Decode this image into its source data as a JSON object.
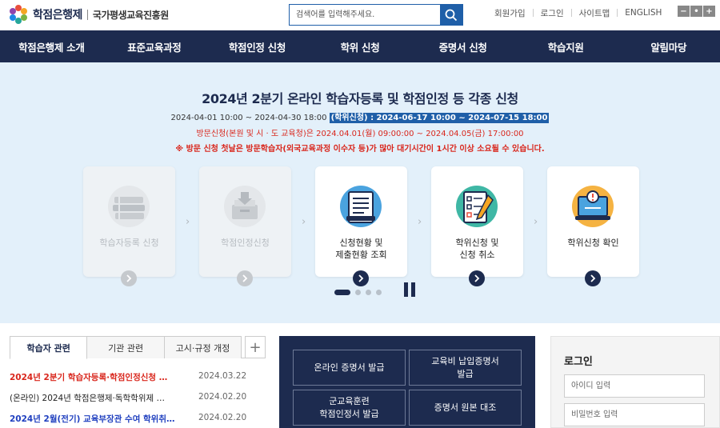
{
  "header": {
    "logo_title": "학점은행제",
    "logo_org": "국가평생교육진흥원",
    "search_placeholder": "검색어를 입력해주세요.",
    "util_links": [
      "회원가입",
      "로그인",
      "사이트맵",
      "ENGLISH"
    ],
    "font_controls": [
      "−",
      "•",
      "+"
    ]
  },
  "gnb": [
    "학점은행제 소개",
    "표준교육과정",
    "학점인정 신청",
    "학위 신청",
    "증명서 신청",
    "학습지원",
    "알림마당"
  ],
  "banner": {
    "title": "2024년 2분기 온라인 학습자등록 및 학점인정 등 각종 신청",
    "date_plain": "2024-04-01 10:00 ~ 2024-04-30 18:00 ",
    "date_highlight": "(학위신청) : 2024-06-17 10:00 ~ 2024-07-15 18:00",
    "visit": "방문신청(본원 및 시 · 도 교육청)은 2024.04.01(월) 09:00:00 ~ 2024.04.05(금) 17:00:00",
    "note": "※ 방문 신청 첫날은 방문학습자(외국교육과정 이수자 등)가 많아 대기시간이 1시간 이상 소요될 수 있습니다."
  },
  "cards": [
    {
      "label": "학습자등록 신청",
      "icon": "books-icon",
      "active": false
    },
    {
      "label": "학점인정신청",
      "icon": "inbox-download-icon",
      "active": false
    },
    {
      "label": "신청현황 및\n제출현황 조회",
      "icon": "document-list-icon",
      "active": true
    },
    {
      "label": "학위신청 및\n신청 취소",
      "icon": "checklist-pencil-icon",
      "active": true
    },
    {
      "label": "학위신청 확인",
      "icon": "laptop-alert-icon",
      "active": true
    }
  ],
  "slider": {
    "pages": 4,
    "current": 1
  },
  "news": {
    "tabs": [
      "학습자 관련",
      "기관 관련",
      "고시·규정 개정"
    ],
    "active_tab": 0,
    "plus": "+",
    "items": [
      {
        "title": "2024년 2분기 학습자등록·학점인정신청 …",
        "date": "2024.03.22",
        "style": "red"
      },
      {
        "title": "(온라인) 2024년 학점은행제·독학학위제 …",
        "date": "2024.02.20",
        "style": "normal"
      },
      {
        "title": "2024년 2월(전기) 교육부장관 수여 학위취…",
        "date": "2024.02.20",
        "style": "blue"
      }
    ]
  },
  "services": [
    "온라인 증명서 발급",
    "교육비 납입증명서\n발급",
    "군교육훈련\n학점인정서 발급",
    "증명서 원본 대조"
  ],
  "login": {
    "title": "로그인",
    "id_placeholder": "아이디 입력",
    "pw_placeholder": "비밀번호 입력"
  },
  "colors": {
    "navy": "#1d2b4f",
    "blue": "#1f5fa8",
    "red": "#d9261c",
    "banner_bg": "#e3f0fa"
  }
}
